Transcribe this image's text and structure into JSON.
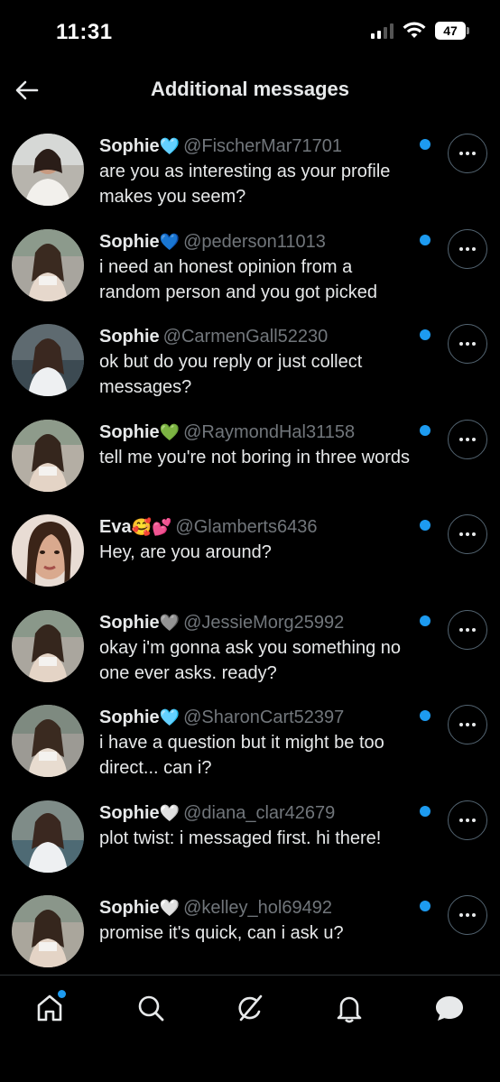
{
  "status_bar": {
    "time": "11:31",
    "battery": "47"
  },
  "header": {
    "title": "Additional messages"
  },
  "messages": [
    {
      "name": "Sophie",
      "emoji": "🩵",
      "handle": "@FischerMar71701",
      "text": "are you as interesting as your profile makes you seem?"
    },
    {
      "name": "Sophie",
      "emoji": "💙",
      "handle": "@pederson11013",
      "text": "i need an honest opinion from a random person and you got picked"
    },
    {
      "name": "Sophie",
      "emoji": "",
      "handle": "@CarmenGall52230",
      "text": "ok but do you reply or just collect messages?"
    },
    {
      "name": "Sophie",
      "emoji": "💚",
      "handle": "@RaymondHal31158",
      "text": "tell me you're not boring in three words"
    },
    {
      "name": "Eva",
      "emoji": "🥰💕",
      "handle": "@Glamberts6436",
      "text": "Hey, are you around?"
    },
    {
      "name": "Sophie",
      "emoji": "🩶",
      "handle": "@JessieMorg25992",
      "text": "okay i'm gonna ask you something no one ever asks. ready?"
    },
    {
      "name": "Sophie",
      "emoji": "🩵",
      "handle": "@SharonCart52397",
      "text": "i have a question but it might be too direct... can i?"
    },
    {
      "name": "Sophie",
      "emoji": "🤍",
      "handle": "@diana_clar42679",
      "text": "plot twist: i messaged first. hi there!"
    },
    {
      "name": "Sophie",
      "emoji": "🤍",
      "handle": "@kelley_hol69492",
      "text": "promise it's quick, can i ask u?"
    }
  ],
  "tabs": [
    "home-icon",
    "search-icon",
    "grok-icon",
    "notifications-icon",
    "messages-icon"
  ],
  "colors": {
    "accent": "#1d9bf0",
    "handle": "#71767b",
    "background": "#000000"
  }
}
